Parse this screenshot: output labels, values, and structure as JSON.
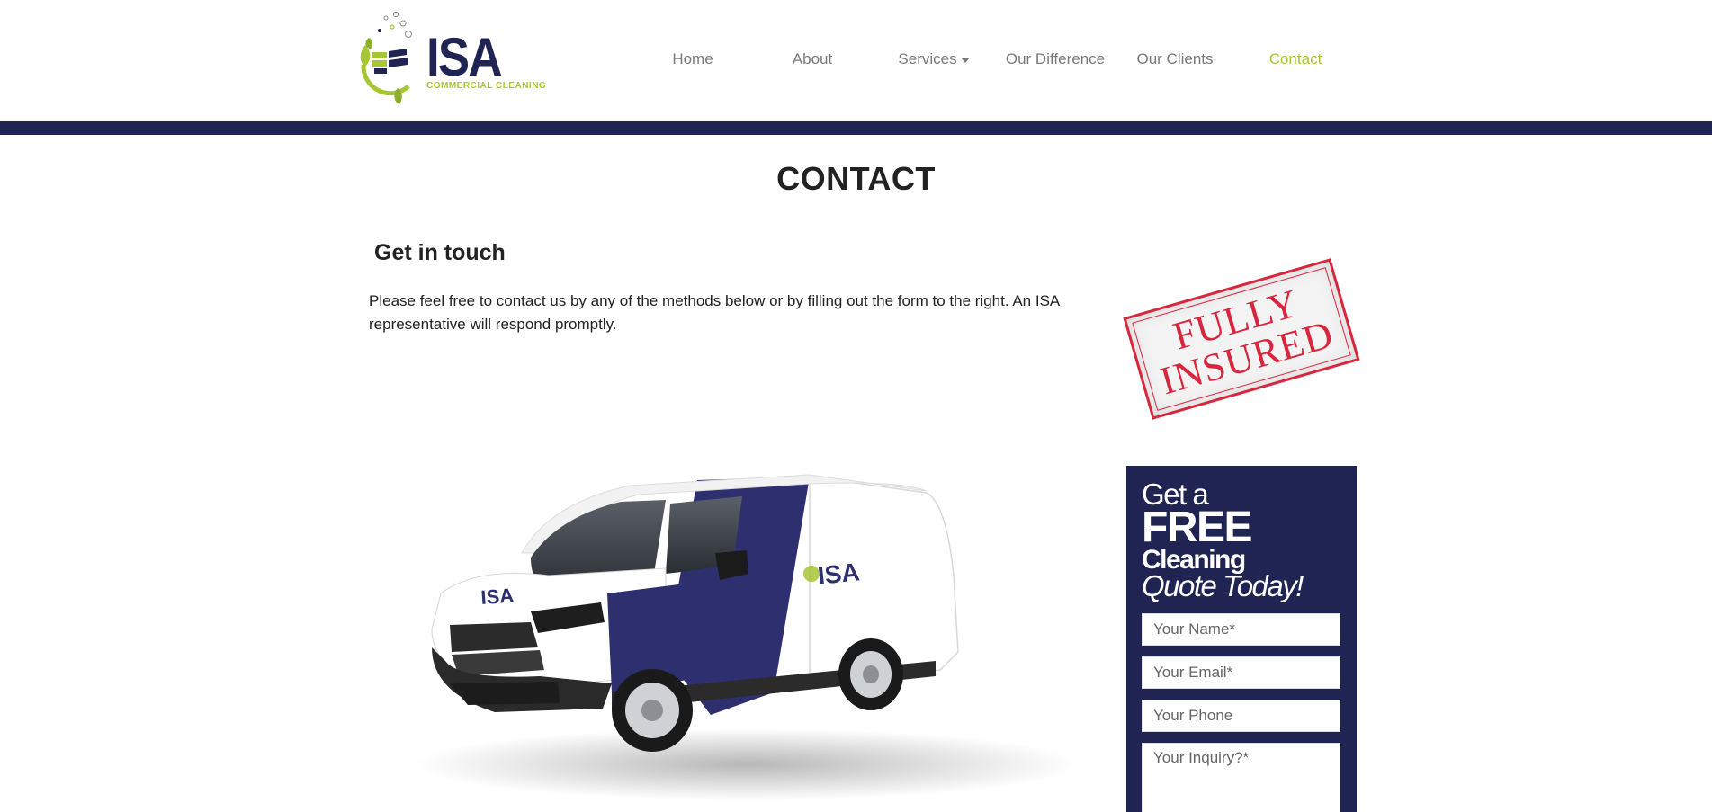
{
  "brand": {
    "name": "ISA",
    "tagline": "COMMERCIAL CLEANING",
    "colors": {
      "navy": "#1f2452",
      "green": "#a6c635",
      "stamp_red": "#d7263d"
    }
  },
  "nav": {
    "items": [
      {
        "label": "Home"
      },
      {
        "label": "About"
      },
      {
        "label": "Services"
      },
      {
        "label": "Our Difference"
      },
      {
        "label": "Our Clients"
      },
      {
        "label": "Contact"
      }
    ],
    "active": "Contact"
  },
  "main": {
    "title": "CONTACT",
    "heading": "Get in touch",
    "intro": "Please feel free to contact us by any of the methods below or by filling out the form to the right. An ISA representative will respond promptly."
  },
  "stamp": {
    "line1": "FULLY",
    "line2": "INSURED"
  },
  "van": {
    "logo_text": "ISA"
  },
  "quote": {
    "line1": "Get a",
    "line2": "FREE",
    "line3": "Cleaning",
    "line4": "Quote Today!",
    "fields": {
      "name_placeholder": "Your Name*",
      "email_placeholder": "Your Email*",
      "phone_placeholder": "Your Phone",
      "inquiry_placeholder": "Your Inquiry?*"
    }
  }
}
